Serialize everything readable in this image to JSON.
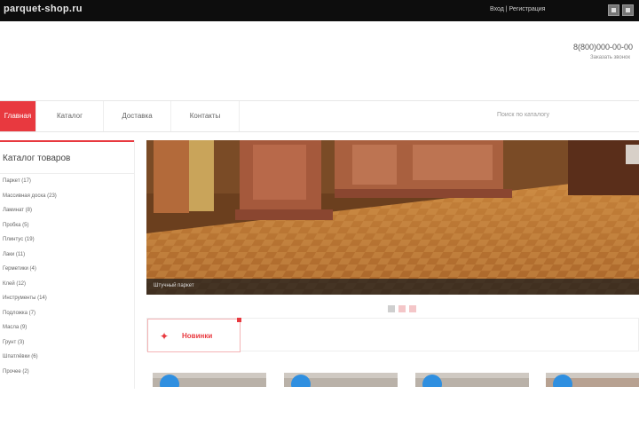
{
  "topbar": {
    "site_title": "parquet-shop.ru",
    "login_text": "Вход | Регистрация"
  },
  "header": {
    "phone": "8(800)000-00-00",
    "subtext": "Заказать звонок"
  },
  "nav": {
    "items": [
      {
        "label": "Главная",
        "active": true
      },
      {
        "label": "Каталог",
        "active": false
      },
      {
        "label": "Доставка",
        "active": false
      },
      {
        "label": "Контакты",
        "active": false
      }
    ],
    "search_placeholder": "Поиск по каталогу"
  },
  "sidebar": {
    "title": "Каталог товаров",
    "items": [
      "Паркет (17)",
      "Массивная доска (23)",
      "Ламинат (8)",
      "Пробка (5)",
      "Плинтус (19)",
      "Лаки (11)",
      "Герметики (4)",
      "Клей (12)",
      "Инструменты (14)",
      "Подложка (7)",
      "Масла (9)",
      "Грунт (3)",
      "Шпатлёвки (6)",
      "Прочее (2)"
    ]
  },
  "slider": {
    "caption": "Штучный паркет",
    "dots": [
      true,
      false,
      false
    ]
  },
  "news": {
    "label": "Новинки"
  },
  "colors": {
    "accent": "#e8393f",
    "topbar": "#0d0d0d",
    "badge": "#2f8fe0"
  },
  "icons": {
    "news": "fire-icon"
  }
}
